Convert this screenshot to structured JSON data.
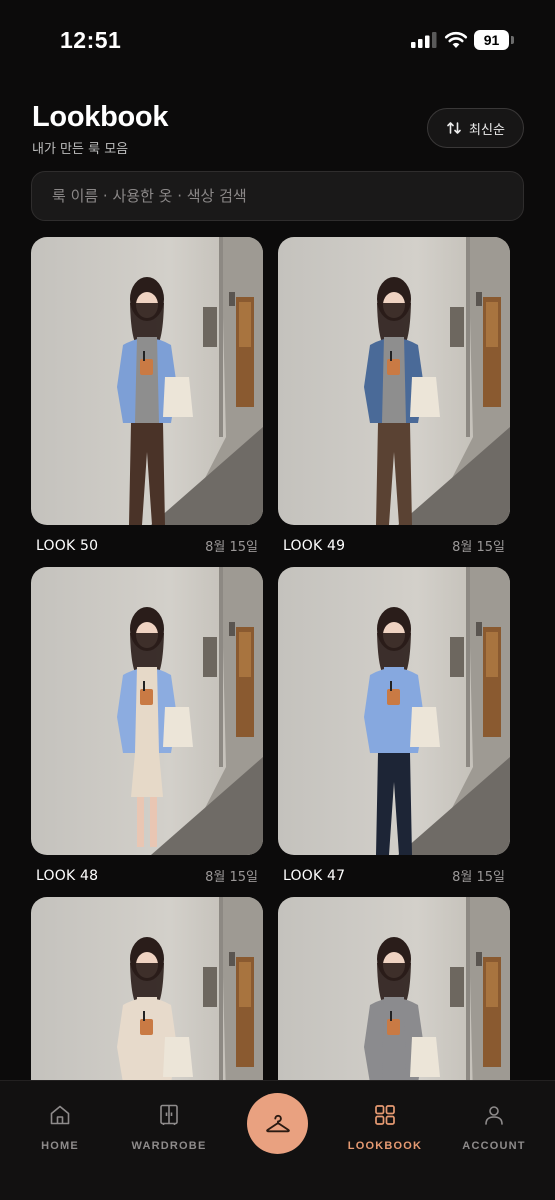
{
  "status_bar": {
    "time": "12:51",
    "battery": "91"
  },
  "header": {
    "title": "Lookbook",
    "subtitle": "내가 만든 룩 모음"
  },
  "sort": {
    "label": "최신순",
    "icon": "sort-arrows-icon"
  },
  "search": {
    "placeholder": "룩 이름 · 사용한 옷 · 색상 검색",
    "value": ""
  },
  "looks": [
    {
      "name": "LOOK 50",
      "date": "8월 15일",
      "outfit": "light blue shirt over gray tee, brown wide pants",
      "top": "#7d9fd6",
      "inner": "#8e8e8e",
      "bottom": "#4a3328"
    },
    {
      "name": "LOOK 49",
      "date": "8월 15일",
      "outfit": "denim jacket over gray tee, brown pants",
      "top": "#4a6a98",
      "inner": "#8e8e8e",
      "bottom": "#5a4233"
    },
    {
      "name": "LOOK 48",
      "date": "8월 15일",
      "outfit": "light blue shirt over cream dress",
      "top": "#8cace0",
      "inner": "#e6d9c8",
      "bottom": "#e6d9c8"
    },
    {
      "name": "LOOK 47",
      "date": "8월 15일",
      "outfit": "light blue shirt, dark jeans",
      "top": "#86a8df",
      "inner": "#86a8df",
      "bottom": "#1d2536"
    },
    {
      "name": "",
      "date": "",
      "outfit": "cream sleeveless dress",
      "top": "#e7dacb",
      "inner": "#e7dacb",
      "bottom": "#e7dacb"
    },
    {
      "name": "",
      "date": "",
      "outfit": "gray top, brown skirt",
      "top": "#8b8b8e",
      "inner": "#8b8b8e",
      "bottom": "#5b4536"
    }
  ],
  "nav": {
    "items": [
      {
        "label": "HOME",
        "icon": "home-icon"
      },
      {
        "label": "WARDROBE",
        "icon": "wardrobe-icon"
      },
      {
        "label": "LOOKBOOK",
        "icon": "grid-icon",
        "active": true
      },
      {
        "label": "ACCOUNT",
        "icon": "user-icon"
      }
    ],
    "center_action_icon": "hanger-icon"
  },
  "colors": {
    "background": "#0c0b0b",
    "accent": "#e69a72",
    "fab": "#e9a180"
  }
}
